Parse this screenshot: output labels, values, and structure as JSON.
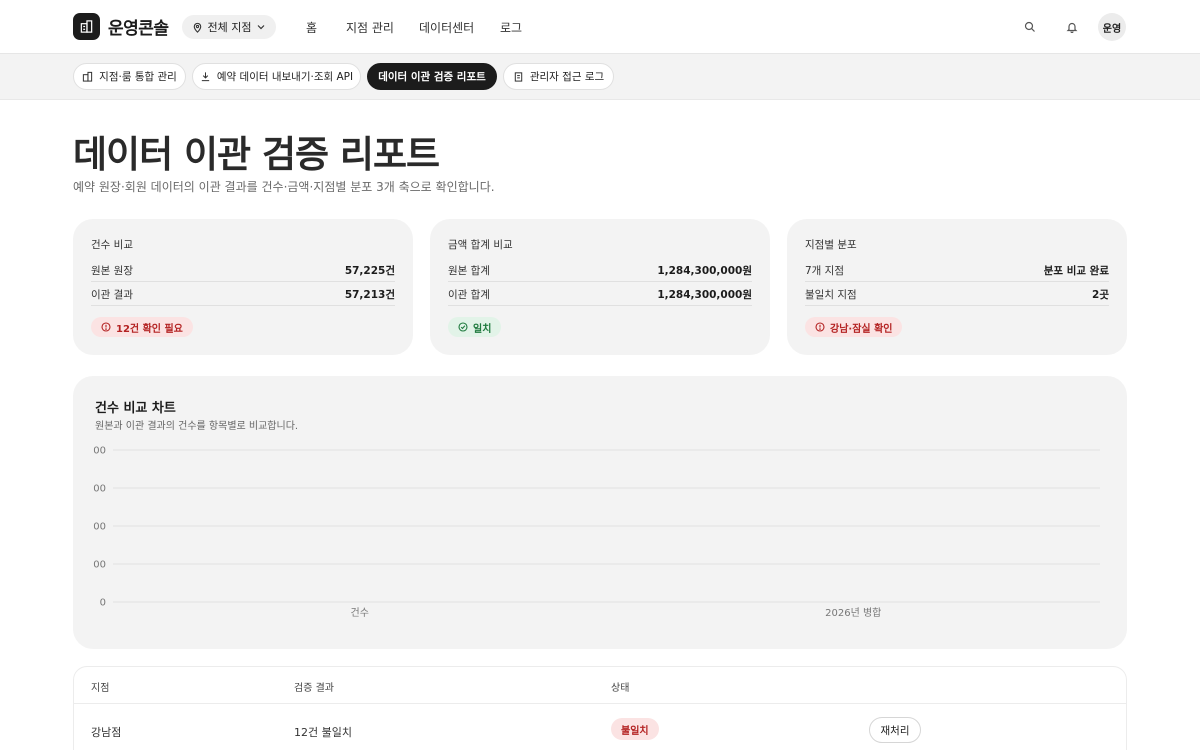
{
  "app": {
    "brand": "운영콘솔",
    "branch_selector": "전체 지점",
    "nav": [
      "홈",
      "지점 관리",
      "데이터센터",
      "로그"
    ],
    "avatar": "운영"
  },
  "tabs": [
    {
      "label": "지점·룸 통합 관리",
      "icon": "building-icon",
      "active": false
    },
    {
      "label": "예약 데이터 내보내기·조회 API",
      "icon": "download-icon",
      "active": false
    },
    {
      "label": "데이터 이관 검증 리포트",
      "icon": "",
      "active": true
    },
    {
      "label": "관리자 접근 로그",
      "icon": "clipboard-icon",
      "active": false
    }
  ],
  "page": {
    "title": "데이터 이관 검증 리포트",
    "subtitle": "예약 원장·회원 데이터의 이관 결과를 건수·금액·지점별 분포 3개 축으로 확인합니다."
  },
  "cards": [
    {
      "title": "건수 비교",
      "rows": [
        {
          "label": "원본 원장",
          "value": "57,225건"
        },
        {
          "label": "이관 결과",
          "value": "57,213건"
        }
      ],
      "badge": {
        "text": "12건 확인 필요",
        "tone": "red",
        "icon": "alert-circle-icon"
      }
    },
    {
      "title": "금액 합계 비교",
      "rows": [
        {
          "label": "원본 합계",
          "value": "1,284,300,000원"
        },
        {
          "label": "이관 합계",
          "value": "1,284,300,000원"
        }
      ],
      "badge": {
        "text": "일치",
        "tone": "green",
        "icon": "check-circle-icon"
      }
    },
    {
      "title": "지점별 분포",
      "rows": [
        {
          "label": "7개 지점",
          "value": "분포 비교 완료"
        },
        {
          "label": "불일치 지점",
          "value": "2곳"
        }
      ],
      "badge": {
        "text": "강남·잠실 확인",
        "tone": "red",
        "icon": "alert-circle-icon"
      }
    }
  ],
  "chart": {
    "title": "건수 비교 차트",
    "subtitle": "원본과 이관 결과의 건수를 항목별로 비교합니다."
  },
  "chart_data": {
    "type": "bar",
    "categories": [
      "건수",
      "2026년 병합"
    ],
    "y_tick_labels": [
      "00",
      "00",
      "00",
      "00",
      "0"
    ],
    "series": [],
    "grid": true,
    "legend": "none"
  },
  "table": {
    "headers": [
      "지점",
      "검증 결과",
      "상태"
    ],
    "rows": [
      {
        "branch": "강남점",
        "result": "12건 불일치",
        "status": "불일치",
        "action": "재처리"
      }
    ]
  },
  "colors": {
    "ink": "#1c1c1c",
    "card_bg": "#f3f3f3",
    "danger_bg": "#fbe3e3",
    "danger": "#b42323",
    "success_bg": "#e2f3e8",
    "success": "#1f7a3e"
  }
}
